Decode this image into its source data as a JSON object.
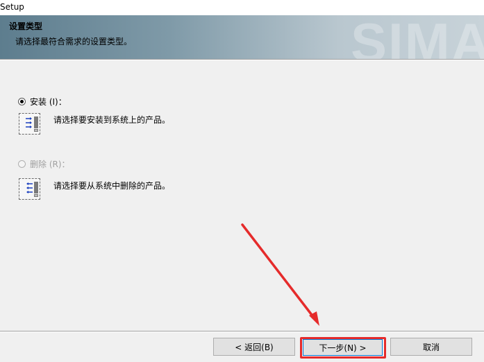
{
  "window": {
    "title": "Setup"
  },
  "header": {
    "title": "设置类型",
    "subtitle": "请选择最符合需求的设置类型。",
    "watermark": "SIMA"
  },
  "options": [
    {
      "label": "安装 (I)：",
      "description": "请选择要安装到系统上的产品。",
      "selected": true,
      "enabled": true,
      "icon": "install-icon"
    },
    {
      "label": "删除 (R)：",
      "description": "请选择要从系统中删除的产品。",
      "selected": false,
      "enabled": false,
      "icon": "remove-icon"
    }
  ],
  "buttons": {
    "back": "< 返回(B)",
    "next": "下一步(N) >",
    "cancel": "取消"
  },
  "colors": {
    "accent": "#0078d7",
    "annotation": "#e52b2b"
  }
}
